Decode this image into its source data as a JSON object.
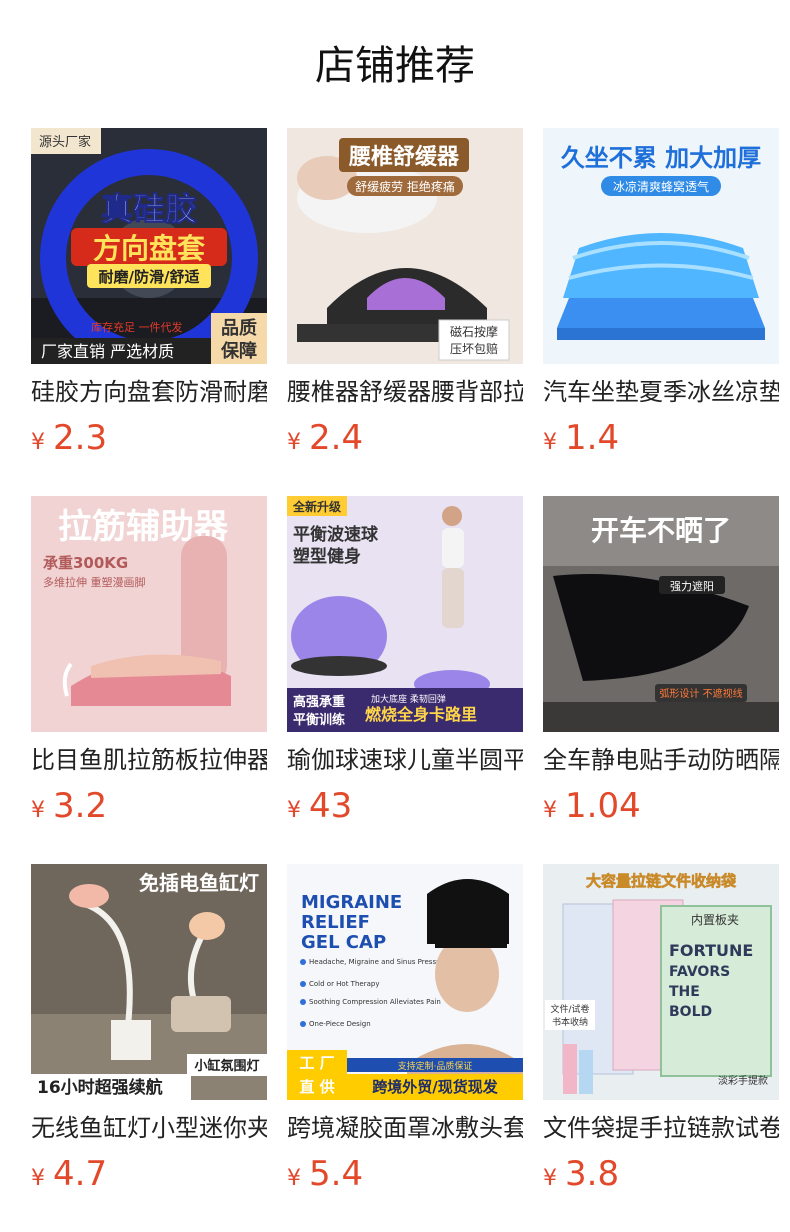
{
  "header": {
    "title": "店铺推荐"
  },
  "currency_symbol": "¥",
  "accent_color": "#e2492b",
  "products": [
    {
      "name": "硅胶方向盘套防滑耐磨",
      "price": "2.3",
      "image_texts": [
        "源头厂家",
        "真硅胶",
        "方向盘套",
        "耐磨/防滑/舒适",
        "库存充足 一件代发",
        "厂家直销 严选材质",
        "品质",
        "保障"
      ]
    },
    {
      "name": "腰椎器舒缓器腰背部拉伸",
      "price": "2.4",
      "image_texts": [
        "腰椎舒缓器",
        "舒缓疲劳 拒绝疼痛",
        "磁石按摩",
        "压坏包赔"
      ]
    },
    {
      "name": "汽车坐垫夏季冰丝凉垫",
      "price": "1.4",
      "image_texts": [
        "久坐不累 加大加厚",
        "冰凉清爽蜂窝透气"
      ]
    },
    {
      "name": "比目鱼肌拉筋板拉伸器",
      "price": "3.2",
      "image_texts": [
        "拉筋辅助器",
        "承重300KG",
        "多维拉伸 重塑漫画脚"
      ]
    },
    {
      "name": "瑜伽球速球儿童半圆平衡",
      "price": "43",
      "image_texts": [
        "全新升级",
        "平衡波速球",
        "塑型健身",
        "高强承重",
        "平衡训练",
        "燃烧全身卡路里",
        "加大底座 柔韧回弹"
      ]
    },
    {
      "name": "全车静电贴手动防晒隔热",
      "price": "1.04",
      "image_texts": [
        "开车不晒了",
        "强力遮阳",
        "弧形设计 不遮视线"
      ]
    },
    {
      "name": "无线鱼缸灯小型迷你夹灯",
      "price": "4.7",
      "image_texts": [
        "免插电鱼缸灯",
        "小缸氛围灯",
        "16小时超强续航"
      ]
    },
    {
      "name": "跨境凝胶面罩冰敷头套",
      "price": "5.4",
      "image_texts": [
        "MIGRAINE",
        "RELIEF",
        "GEL CAP",
        "Headache, Migraine and Sinus Pressure Relief",
        "Cold or Hot Therapy",
        "Soothing Compression Alleviates Pain",
        "One-Piece Design",
        "工 厂",
        "直 供",
        "支持定制·品质保证",
        "跨境外贸/现货现发"
      ]
    },
    {
      "name": "文件袋提手拉链款试卷袋",
      "price": "3.8",
      "image_texts": [
        "大容量拉链文件收纳袋",
        "内置板夹",
        "FORTUNE",
        "FAVORS",
        "THE",
        "BOLD",
        "文件/试卷",
        "书本收纳",
        "淡彩手提款"
      ]
    }
  ]
}
